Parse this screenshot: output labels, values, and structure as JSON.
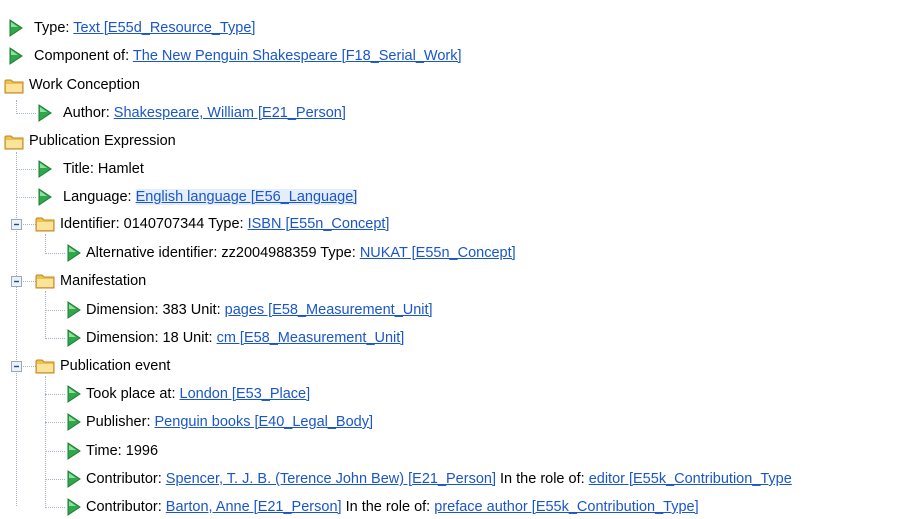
{
  "tree": {
    "type": {
      "label": "Type:",
      "link": "Text [E55d_Resource_Type]"
    },
    "component_of": {
      "label": "Component of:",
      "link": "The New Penguin Shakespeare [F18_Serial_Work]"
    },
    "work_conception": {
      "label": "Work Conception",
      "author": {
        "label": "Author:",
        "link": "Shakespeare, William [E21_Person]"
      }
    },
    "publication_expression": {
      "label": "Publication Expression",
      "title": {
        "label": "Title:",
        "value": "Hamlet"
      },
      "language": {
        "label": "Language:",
        "link": "English language [E56_Language]"
      },
      "identifier": {
        "label": "Identifier: 0140707344 Type:",
        "link": "ISBN [E55n_Concept]",
        "alt": {
          "label": "Alternative identifier: zz2004988359 Type:",
          "link": "NUKAT [E55n_Concept]"
        }
      },
      "manifestation": {
        "label": "Manifestation",
        "dim1": {
          "label": "Dimension: 383 Unit:",
          "link": "pages [E58_Measurement_Unit]"
        },
        "dim2": {
          "label": "Dimension: 18 Unit:",
          "link": "cm [E58_Measurement_Unit]"
        }
      },
      "publication_event": {
        "label": "Publication event",
        "place": {
          "label": "Took place at:",
          "link": "London [E53_Place]"
        },
        "publisher": {
          "label": "Publisher:",
          "link": "Penguin books [E40_Legal_Body]"
        },
        "time": {
          "label": "Time:",
          "value": "1996"
        },
        "contrib1": {
          "label": "Contributor:",
          "link": "Spencer, T. J. B. (Terence John Bew) [E21_Person]",
          "role_label": "In the role of:",
          "role_link": "editor [E55k_Contribution_Type"
        },
        "contrib2": {
          "label": "Contributor:",
          "link": "Barton, Anne [E21_Person]",
          "role_label": "In the role of:",
          "role_link": "preface author [E55k_Contribution_Type]"
        }
      }
    }
  },
  "colors": {
    "link": "#1a56c9",
    "leaf_icon": "#2ea84a",
    "folder_icon": "#f0c24a",
    "tree_lines": "#a8b4c6"
  },
  "icons": {
    "leaf": "green-arrow-icon",
    "folder": "folder-icon",
    "toggle": "collapse-toggle-icon"
  }
}
